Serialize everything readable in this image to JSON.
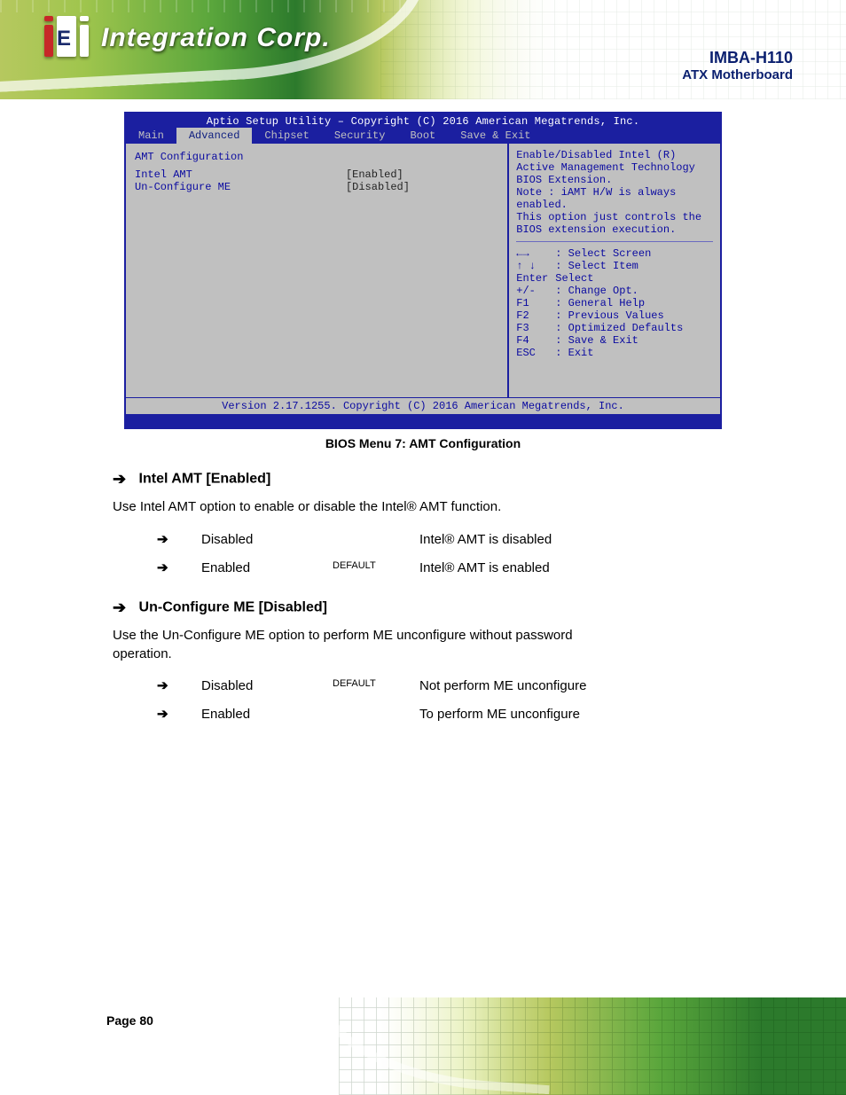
{
  "header": {
    "logo_text": "Integration Corp.",
    "product_name": "IMBA-H110",
    "product_type": "ATX Motherboard"
  },
  "bios": {
    "title": "Aptio Setup Utility – Copyright (C) 2016 American Megatrends, Inc.",
    "tabs": [
      "Main",
      "Advanced",
      "Chipset",
      "Security",
      "Boot",
      "Save & Exit"
    ],
    "active_tab_index": 1,
    "left_rows": [
      {
        "label": "AMT Configuration",
        "value": ""
      },
      {
        "label": "Intel AMT",
        "value": "[Enabled]"
      },
      {
        "label": "Un-Configure ME",
        "value": "[Disabled]"
      }
    ],
    "right_help_lines": [
      "Enable/Disabled Intel (R)",
      "Active Management Technology",
      "BIOS Extension.",
      "Note : iAMT H/W is always",
      "enabled.",
      "This option just controls the",
      "BIOS extension execution."
    ],
    "keys": [
      {
        "k": "←→",
        "d": ": Select Screen"
      },
      {
        "k": "↑ ↓",
        "d": ": Select Item"
      },
      {
        "k": "Enter",
        "d": "Select"
      },
      {
        "k": "+/-",
        "d": ": Change Opt."
      },
      {
        "k": "F1",
        "d": ": General Help"
      },
      {
        "k": "F2",
        "d": ": Previous Values"
      },
      {
        "k": "F3",
        "d": ": Optimized Defaults"
      },
      {
        "k": "F4",
        "d": ": Save & Exit"
      },
      {
        "k": "ESC",
        "d": ": Exit"
      }
    ],
    "footer": "Version 2.17.1255. Copyright (C) 2016 American Megatrends, Inc."
  },
  "caption": "BIOS Menu 7: AMT Configuration",
  "options": [
    {
      "title": "Intel AMT [Enabled]",
      "desc": "Use Intel AMT option to enable or disable the Intel® AMT function.",
      "rows": [
        {
          "name": "Disabled",
          "def": "",
          "text": "Intel® AMT is disabled"
        },
        {
          "name": "Enabled",
          "def": "DEFAULT",
          "text": "Intel® AMT is enabled"
        }
      ]
    },
    {
      "title": "Un-Configure ME [Disabled]",
      "desc_lines": [
        "Use the Un-Configure ME option to perform ME unconfigure without password",
        "operation."
      ],
      "rows": [
        {
          "name": "Disabled",
          "def": "DEFAULT",
          "text": "Not perform ME unconfigure"
        },
        {
          "name": "Enabled",
          "def": "",
          "text": "To perform ME unconfigure"
        }
      ]
    }
  ],
  "footer": {
    "page_label": "Page 80",
    "blank_note": ""
  }
}
